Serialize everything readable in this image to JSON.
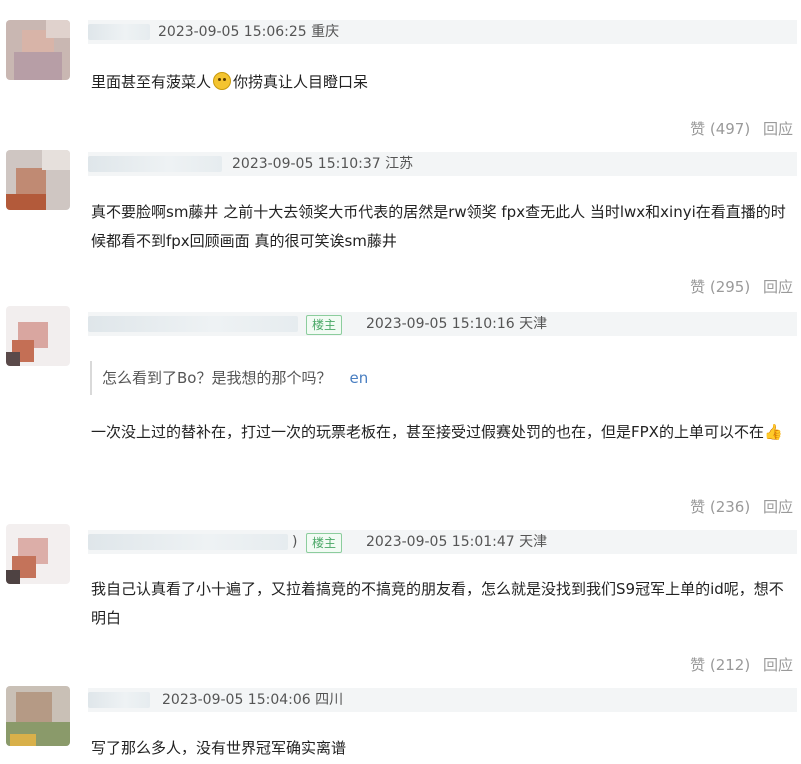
{
  "comments": [
    {
      "meta": "2023-09-05 15:06:25 重庆",
      "text_parts": [
        "里面甚至有菠菜人",
        "你捞真让人目瞪口呆"
      ],
      "like": "赞 (497)",
      "reply": "回应"
    },
    {
      "meta": "2023-09-05 15:10:37 江苏",
      "text": "真不要脸啊sm藤井 之前十大去领奖大币代表的居然是rw领奖 fpx查无此人 当时lwx和xinyi在看直播的时候都看不到fpx回顾画面 真的很可笑诶sm藤井",
      "like": "赞 (295)",
      "reply": "回应"
    },
    {
      "badge": "楼主",
      "meta": "2023-09-05 15:10:16 天津",
      "quote": "怎么看到了Bo？是我想的那个吗？",
      "quote_suffix": "en",
      "text": "一次没上过的替补在，打过一次的玩票老板在，甚至接受过假赛处罚的也在，但是FPX的上单可以不在",
      "like": "赞 (236)",
      "reply": "回应"
    },
    {
      "badge": "楼主",
      "name_tail": ")",
      "meta": "2023-09-05 15:01:47 天津",
      "text": "我自己认真看了小十遍了，又拉着搞竞的不搞竞的朋友看，怎么就是没找到我们S9冠军上单的id呢，想不明白",
      "like": "赞 (212)",
      "reply": "回应"
    },
    {
      "meta": "2023-09-05 15:04:06 四川",
      "text": "写了那么多人，没有世界冠军确实离谱"
    }
  ]
}
